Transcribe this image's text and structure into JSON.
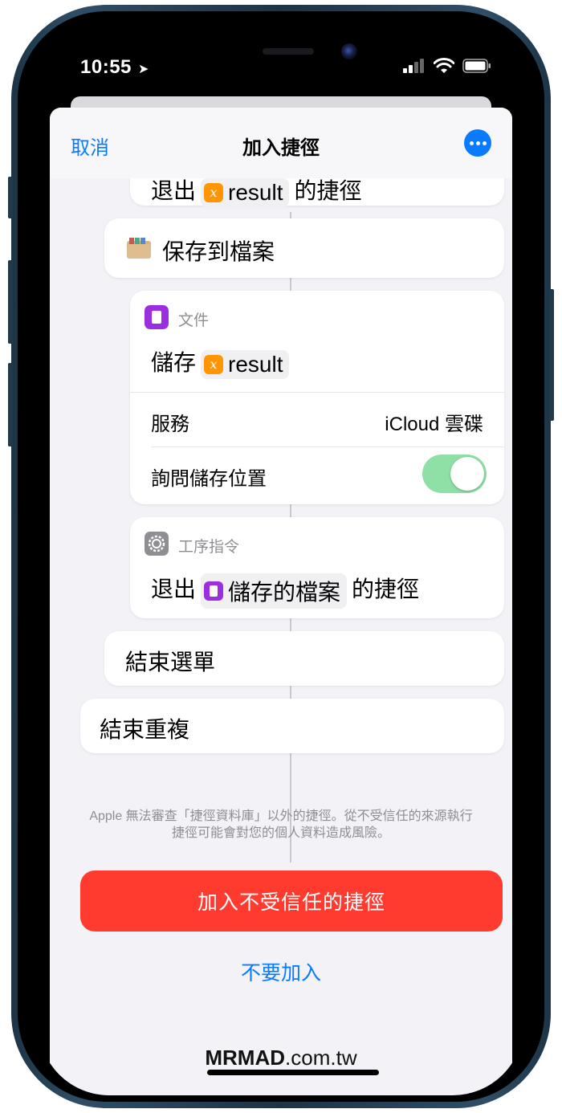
{
  "status_bar": {
    "time": "10:55",
    "location_glyph": "➤"
  },
  "nav": {
    "cancel": "取消",
    "title": "加入捷徑",
    "more_icon": "ellipsis-icon"
  },
  "partial_card": {
    "prefix": "退出",
    "variable": "result",
    "suffix": "的捷徑"
  },
  "save_to_files": {
    "label": "保存到檔案",
    "icon": "file-cabinet-icon"
  },
  "document_action": {
    "category": "文件",
    "action_prefix": "儲存",
    "variable": "result",
    "rows": [
      {
        "label": "服務",
        "value": "iCloud 雲碟"
      },
      {
        "label": "詢問儲存位置",
        "toggle_on": true
      }
    ]
  },
  "scripting_action": {
    "category": "工序指令",
    "prefix": "退出",
    "variable": "儲存的檔案",
    "suffix": "的捷徑"
  },
  "end_menu": "結束選單",
  "end_repeat": "結束重複",
  "footer_line1": "Apple 無法審查「捷徑資料庫」以外的捷徑。從不受信任的來源執行",
  "footer_line2": "捷徑可能會對您的個人資料造成風險。",
  "buttons": {
    "add_untrusted": "加入不受信任的捷徑",
    "dont_add": "不要加入"
  },
  "watermark": {
    "brand": "MRMAD",
    "domain": ".com.tw"
  },
  "colors": {
    "accent": "#0a7aff",
    "danger": "#ff3b30",
    "toggle": "#8fe0a6",
    "variable": "#ff9500",
    "document": "#9b2fe0"
  }
}
